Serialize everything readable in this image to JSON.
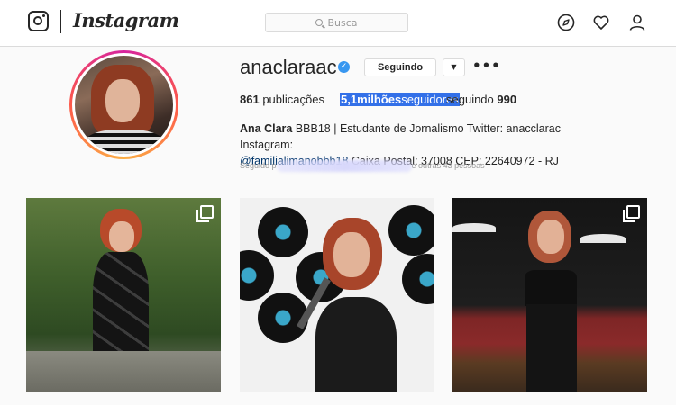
{
  "nav": {
    "logo_text": "Instagram",
    "search_placeholder": "Busca",
    "icons": [
      "compass-icon",
      "heart-icon",
      "user-icon"
    ]
  },
  "profile": {
    "username": "anaclaraac",
    "verified": true,
    "follow_label": "Seguindo",
    "dropdown_symbol": "▼",
    "more_symbol": "•••",
    "posts_count": "861",
    "posts_label": "publicações",
    "followers_count": "5,1milhões",
    "followers_label": "seguidores",
    "following_label": "seguindo",
    "following_count": "990",
    "bio_name": "Ana Clara",
    "bio_line1": "BBB18 | Estudante de Jornalismo Twitter: anacclarac Instagram:",
    "bio_mention": "@familialimanobbb18",
    "bio_line2": "Caixa Postal: 37008 CEP: 22640972 - RJ",
    "followed_by_prefix": "Seguido p",
    "followed_by_suffix": "e outras 43 pessoas"
  },
  "colors": {
    "accent_blue": "#3897f0",
    "highlight": "#3370e8",
    "border": "#dbdbdb"
  },
  "posts": [
    {
      "type": "multi",
      "description_icon": "multiple-photos-icon"
    },
    {
      "type": "single"
    },
    {
      "type": "multi",
      "description_icon": "multiple-photos-icon"
    }
  ]
}
